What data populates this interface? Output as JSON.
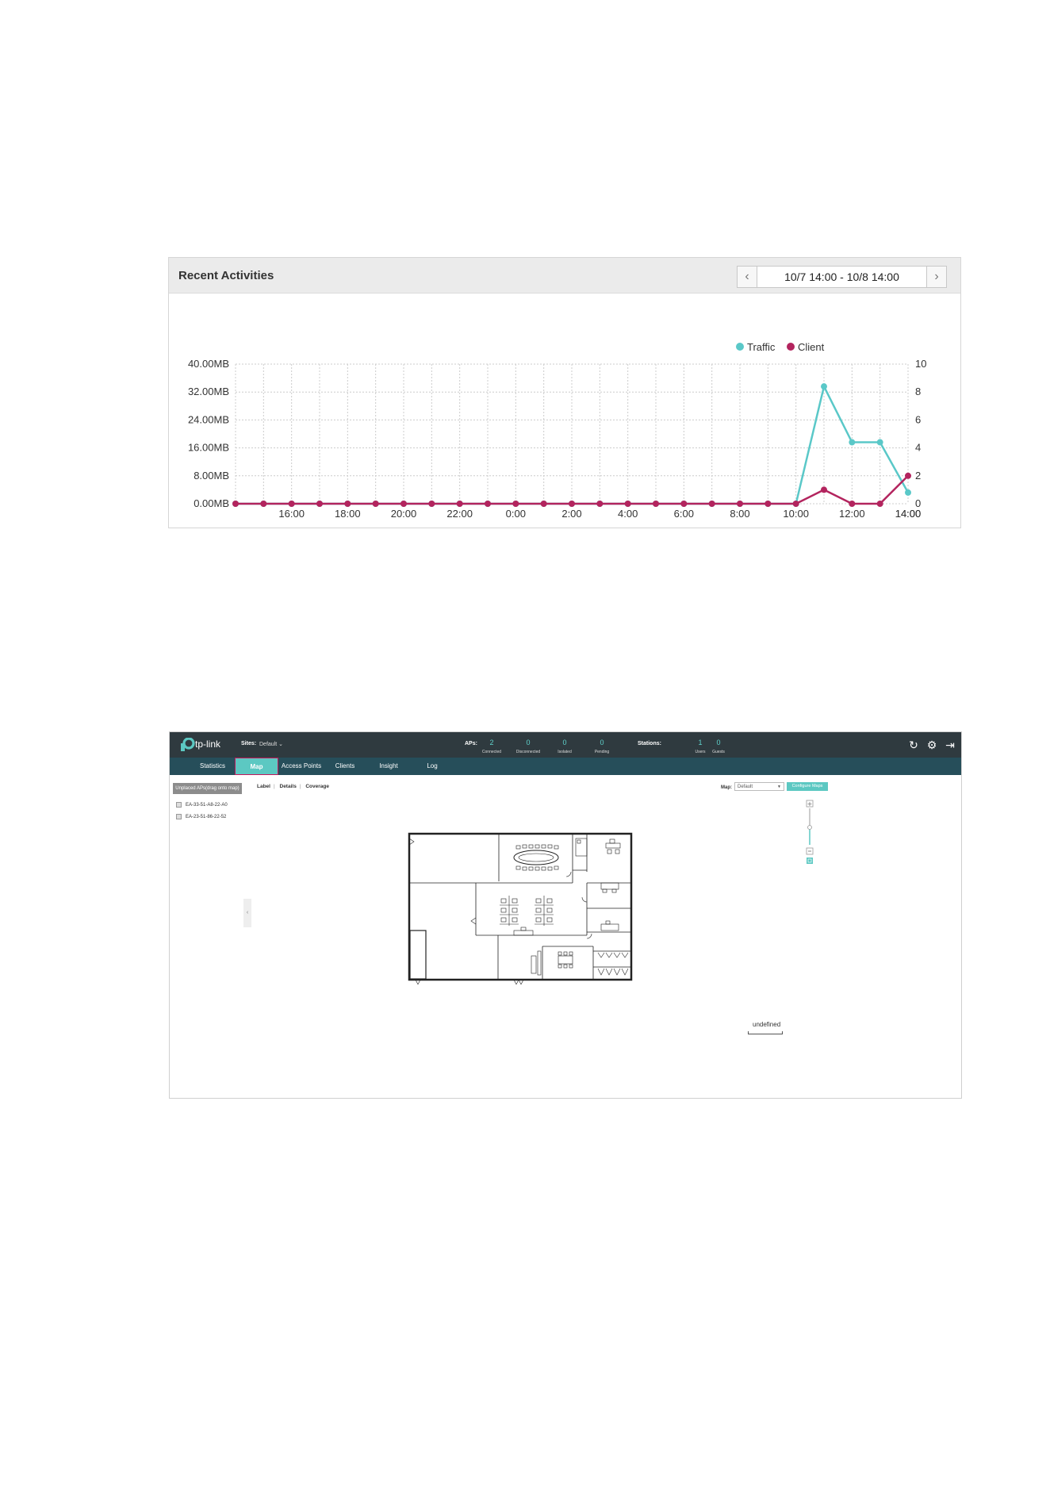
{
  "activities": {
    "title": "Recent Activities",
    "prev_icon": "chevron-left-icon",
    "next_icon": "chevron-right-icon",
    "date_range": "10/7 14:00 - 10/8 14:00"
  },
  "chart_data": {
    "type": "line",
    "x": [
      "14:00",
      "15:00",
      "16:00",
      "17:00",
      "18:00",
      "19:00",
      "20:00",
      "21:00",
      "22:00",
      "23:00",
      "0:00",
      "1:00",
      "2:00",
      "3:00",
      "4:00",
      "5:00",
      "6:00",
      "7:00",
      "8:00",
      "9:00",
      "10:00",
      "11:00",
      "12:00",
      "13:00",
      "14:00"
    ],
    "xticks": [
      "14:00",
      "16:00",
      "18:00",
      "20:00",
      "22:00",
      "0:00",
      "2:00",
      "4:00",
      "6:00",
      "8:00",
      "10:00",
      "12:00",
      "14:00"
    ],
    "series": [
      {
        "name": "Traffic",
        "axis": "left",
        "color": "#5ac8c8",
        "unit": "MB",
        "values": [
          0,
          0,
          0,
          0,
          0,
          0,
          0,
          0,
          0,
          0,
          0,
          0,
          0,
          0,
          0,
          0,
          0,
          0,
          0,
          0,
          0,
          33.6,
          17.6,
          17.6,
          3.2
        ]
      },
      {
        "name": "Client",
        "axis": "right",
        "color": "#b3245e",
        "values": [
          0,
          0,
          0,
          0,
          0,
          0,
          0,
          0,
          0,
          0,
          0,
          0,
          0,
          0,
          0,
          0,
          0,
          0,
          0,
          0,
          0,
          1,
          0,
          0,
          2
        ]
      }
    ],
    "yleft": {
      "ticks": [
        "0.00MB",
        "8.00MB",
        "16.00MB",
        "24.00MB",
        "32.00MB",
        "40.00MB"
      ],
      "range": [
        0,
        40
      ]
    },
    "yright": {
      "ticks": [
        "0",
        "2",
        "4",
        "6",
        "8",
        "10"
      ],
      "range": [
        0,
        10
      ]
    },
    "legend_position": "top-right",
    "grid": true
  },
  "controller": {
    "brand": "tp-link",
    "sites_label": "Sites:",
    "sites_value": "Default",
    "aps_label": "APs:",
    "ap_stats": [
      {
        "value": "2",
        "label": "Connected"
      },
      {
        "value": "0",
        "label": "Disconnected"
      },
      {
        "value": "0",
        "label": "Isolated"
      },
      {
        "value": "0",
        "label": "Pending"
      }
    ],
    "stations_label": "Stations:",
    "station_stats": [
      {
        "value": "1",
        "label": "Users"
      },
      {
        "value": "0",
        "label": "Guests"
      }
    ],
    "icons": [
      "refresh-icon",
      "gear-icon",
      "logout-icon"
    ],
    "nav": [
      "Statistics",
      "Map",
      "Access Points",
      "Clients",
      "Insight",
      "Log"
    ],
    "active_nav": "Map",
    "unplaced_button": "Unplaced APs(drag onto map)",
    "unplaced_aps": [
      "EA-33-51-A8-22-A0",
      "EA-23-51-86-22-52"
    ],
    "view_tabs": [
      "Label",
      "Details",
      "Coverage"
    ],
    "map_label": "Map:",
    "map_value": "Default",
    "configure_button": "Configure Maps",
    "scale_label": "undefined",
    "accent": "#5cc8c2"
  }
}
